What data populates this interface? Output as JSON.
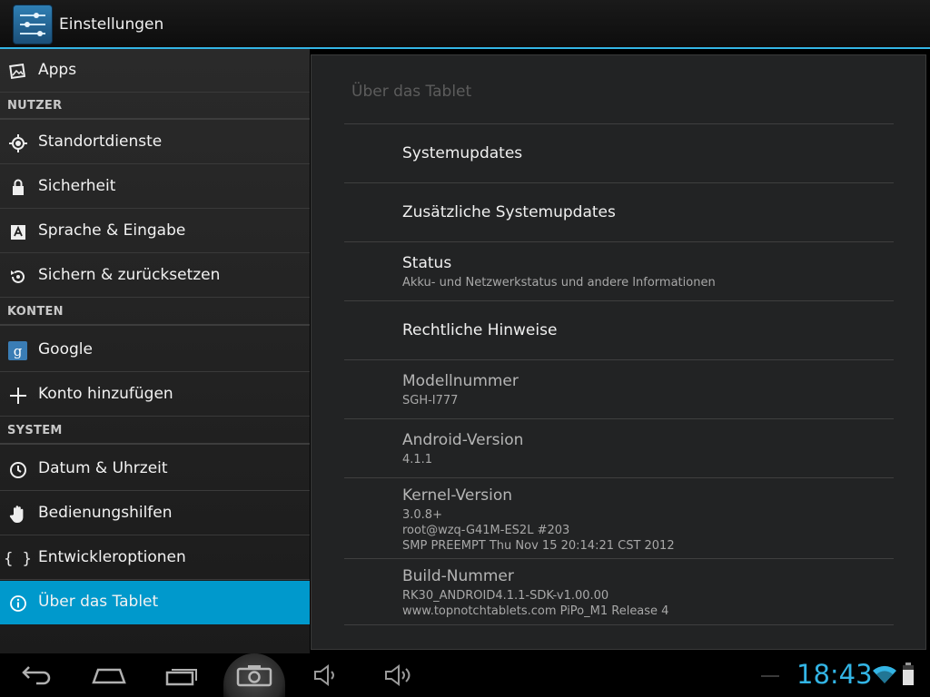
{
  "action_bar": {
    "title": "Einstellungen",
    "icon": "settings-sliders-icon"
  },
  "sidebar": {
    "items": [
      {
        "type": "item",
        "label": "Apps",
        "icon": "apps-icon"
      },
      {
        "type": "header",
        "label": "NUTZER"
      },
      {
        "type": "item",
        "label": "Standortdienste",
        "icon": "location-icon"
      },
      {
        "type": "item",
        "label": "Sicherheit",
        "icon": "lock-icon"
      },
      {
        "type": "item",
        "label": "Sprache & Eingabe",
        "icon": "language-icon"
      },
      {
        "type": "item",
        "label": "Sichern & zurücksetzen",
        "icon": "backup-icon"
      },
      {
        "type": "header",
        "label": "KONTEN"
      },
      {
        "type": "item",
        "label": "Google",
        "icon": "google-icon"
      },
      {
        "type": "item",
        "label": "Konto hinzufügen",
        "icon": "add-icon"
      },
      {
        "type": "header",
        "label": "SYSTEM"
      },
      {
        "type": "item",
        "label": "Datum & Uhrzeit",
        "icon": "clock-icon"
      },
      {
        "type": "item",
        "label": "Bedienungshilfen",
        "icon": "hand-icon"
      },
      {
        "type": "item",
        "label": "Entwickleroptionen",
        "icon": "braces-icon"
      },
      {
        "type": "item",
        "label": "Über das Tablet",
        "icon": "info-icon",
        "selected": true
      }
    ]
  },
  "main": {
    "title": "Über das Tablet",
    "items": [
      {
        "title": "Systemupdates"
      },
      {
        "title": "Zusätzliche Systemupdates"
      },
      {
        "title": "Status",
        "summary": [
          "Akku- und Netzwerkstatus und andere Informationen"
        ]
      },
      {
        "title": "Rechtliche Hinweise"
      },
      {
        "title": "Modellnummer",
        "summary": [
          "SGH-I777"
        ],
        "dim": true
      },
      {
        "title": "Android-Version",
        "summary": [
          "4.1.1"
        ],
        "dim": true
      },
      {
        "title": "Kernel-Version",
        "summary": [
          "3.0.8+",
          "root@wzq-G41M-ES2L #203",
          "SMP PREEMPT Thu Nov 15 20:14:21 CST 2012"
        ],
        "dim": true
      },
      {
        "title": "Build-Nummer",
        "summary": [
          "RK30_ANDROID4.1.1-SDK-v1.00.00",
          "www.topnotchtablets.com PiPo_M1 Release 4"
        ],
        "dim": true
      }
    ]
  },
  "system_bar": {
    "clock": "18:43",
    "nav_icons": [
      "back-icon",
      "home-icon",
      "recent-apps-icon",
      "screenshot-camera-icon",
      "volume-down-icon",
      "volume-up-icon"
    ],
    "status_icons": [
      "wifi-icon",
      "battery-icon"
    ],
    "accent_color": "#33b5e5"
  }
}
